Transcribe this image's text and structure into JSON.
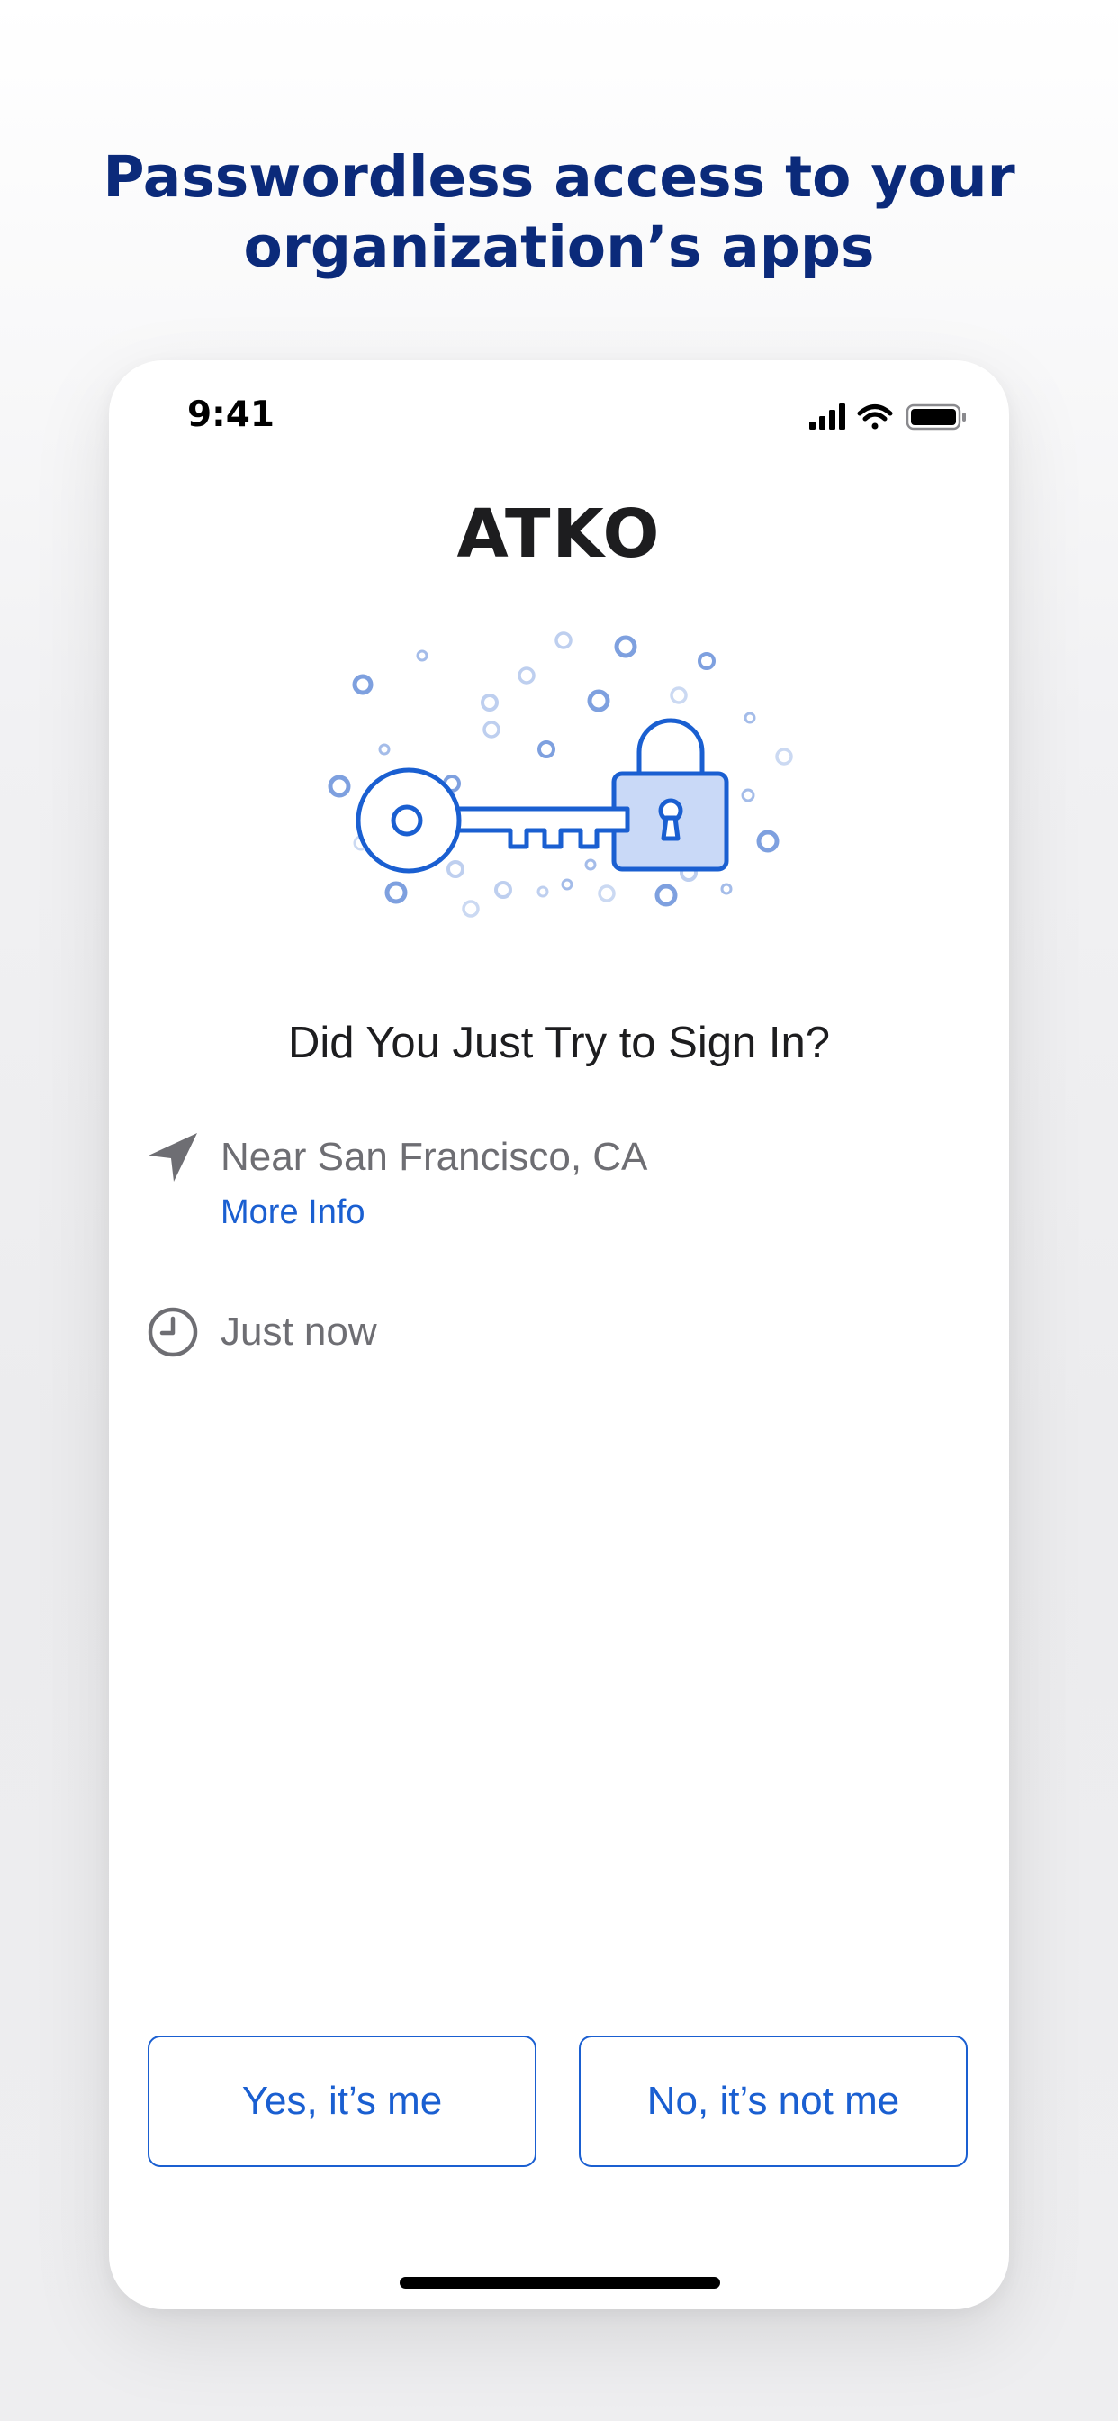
{
  "headline": {
    "line1": "Passwordless access to your",
    "line2": "organization’s apps"
  },
  "status_bar": {
    "time": "9:41",
    "icons": [
      "cellular-signal-icon",
      "wifi-icon",
      "battery-icon"
    ]
  },
  "brand": {
    "name": "ATKO"
  },
  "illustration": {
    "icon": "key-and-padlock-icon"
  },
  "prompt": {
    "title": "Did You Just Try to Sign In?",
    "location": "Near San Francisco, CA",
    "more_info_label": "More Info",
    "time": "Just now",
    "location_icon": "location-arrow-icon",
    "time_icon": "clock-icon"
  },
  "actions": {
    "yes_label": "Yes, it’s me",
    "no_label": "No, it’s not me"
  },
  "colors": {
    "headline": "#0b2a7a",
    "accent": "#1a5fd1",
    "lock_fill": "#c9d9f7",
    "secondary_text": "#6e6e73"
  }
}
